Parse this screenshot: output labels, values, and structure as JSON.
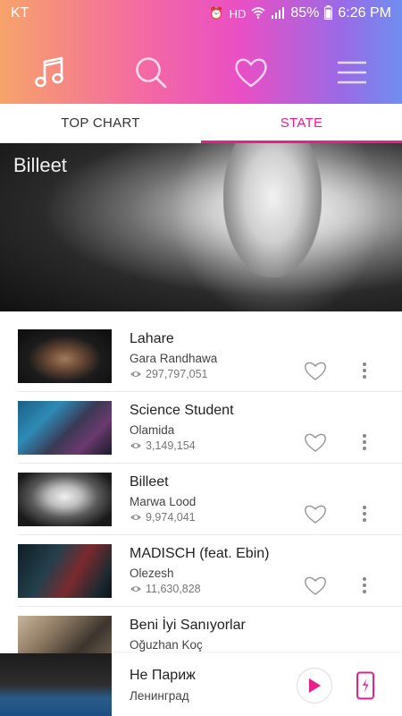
{
  "status": {
    "carrier": "KT",
    "battery": "85%",
    "time": "6:26 PM",
    "hd": "HD"
  },
  "nav": {
    "icons": [
      "music-note-icon",
      "search-icon",
      "heart-icon",
      "menu-icon"
    ]
  },
  "tabs": [
    {
      "label": "TOP CHART",
      "active": false
    },
    {
      "label": "STATE",
      "active": true
    }
  ],
  "banner": {
    "title": "Billeet"
  },
  "songs": [
    {
      "title": "Lahare",
      "artist": "Gara Randhawa",
      "views": "297,797,051"
    },
    {
      "title": "Science Student",
      "artist": "Olamida",
      "views": "3,149,154"
    },
    {
      "title": "Billeet",
      "artist": "Marwa Lood",
      "views": "9,974,041"
    },
    {
      "title": "MADISCH (feat. Ebin)",
      "artist": "Olezesh",
      "views": "11,630,828"
    },
    {
      "title": "Beni İyi Sanıyorlar",
      "artist": "Oğuzhan Koç",
      "views": ""
    }
  ],
  "player": {
    "title": "Не Париж",
    "artist": "Ленинград"
  },
  "colors": {
    "accent": "#e91e8c",
    "gradient_start": "#f7a36a",
    "gradient_end": "#6f8ef0"
  }
}
